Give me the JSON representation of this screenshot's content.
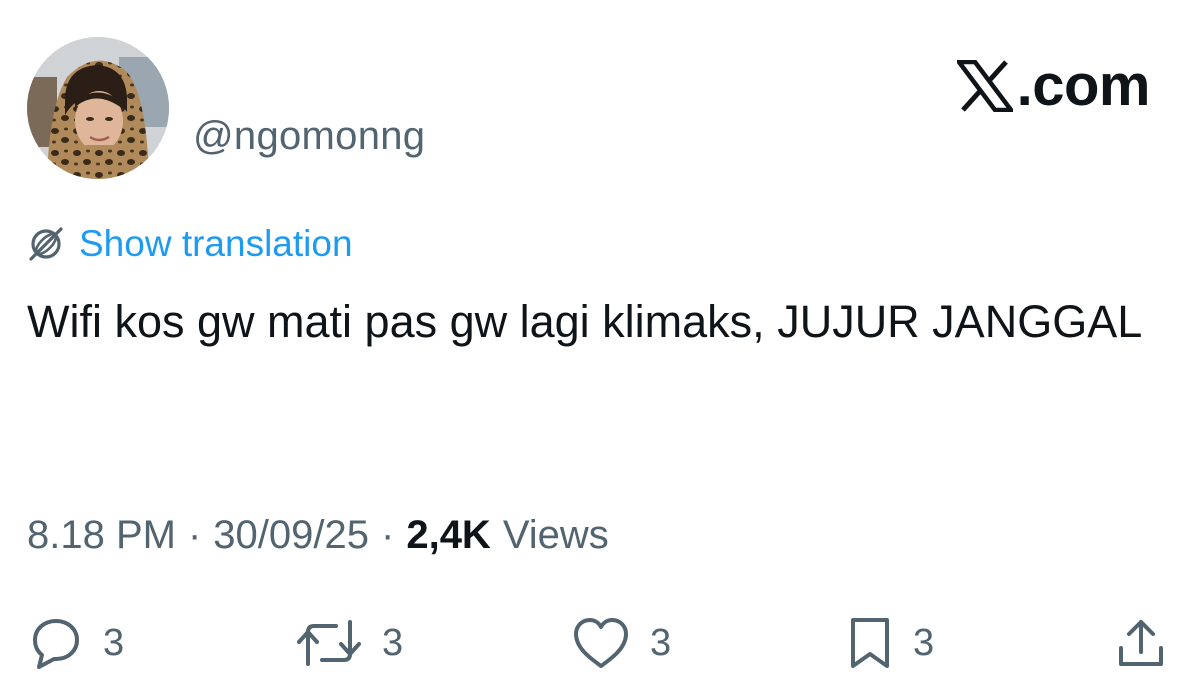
{
  "post": {
    "handle": "@ngomonng",
    "translate_label": "Show translation",
    "text": "Wifi kos gw mati pas gw lagi klimaks, JUJUR JANGGAL",
    "time": "8.18 PM",
    "date": "30/09/25",
    "separator": "·",
    "views_count": "2,4K",
    "views_label": "Views"
  },
  "brand": {
    "text": ".com",
    "icon": "x-logo-icon"
  },
  "actions": {
    "reply_count": "3",
    "repost_count": "3",
    "like_count": "3",
    "bookmark_count": "3"
  },
  "icons": {
    "reply": "reply-icon",
    "repost": "repost-icon",
    "like": "heart-icon",
    "bookmark": "bookmark-icon",
    "share": "share-icon",
    "translate": "globe-icon"
  },
  "colors": {
    "text": "#0f1419",
    "secondary": "#536471",
    "link": "#1d9bf0",
    "background": "#ffffff"
  }
}
